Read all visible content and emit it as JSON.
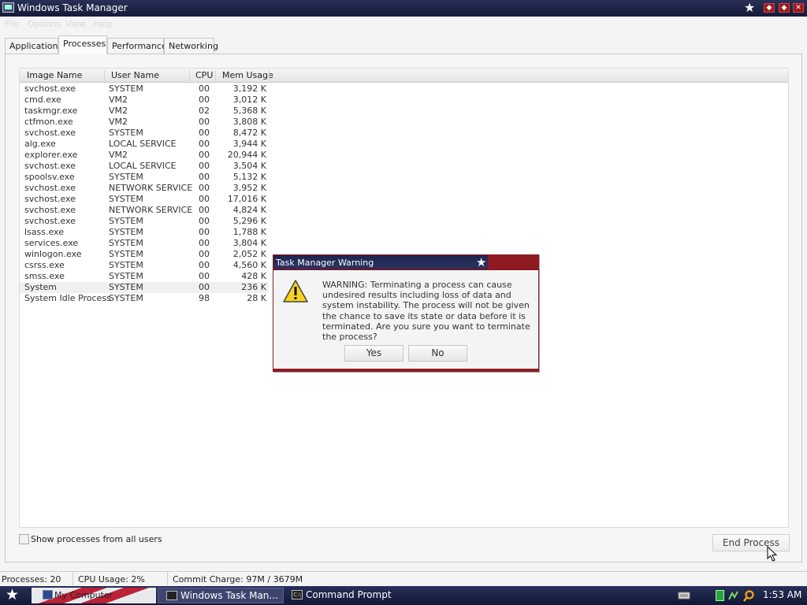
{
  "window": {
    "title": "Windows Task Manager"
  },
  "menu": [
    "File",
    "Options",
    "View",
    "Help"
  ],
  "tabs": [
    "Applications",
    "Processes",
    "Performance",
    "Networking"
  ],
  "active_tab": "Processes",
  "columns": [
    "Image Name",
    "User Name",
    "CPU",
    "Mem Usage"
  ],
  "processes": [
    {
      "name": "svchost.exe",
      "user": "SYSTEM",
      "cpu": "00",
      "mem": "3,192 K"
    },
    {
      "name": "cmd.exe",
      "user": "VM2",
      "cpu": "00",
      "mem": "3,012 K"
    },
    {
      "name": "taskmgr.exe",
      "user": "VM2",
      "cpu": "02",
      "mem": "5,368 K"
    },
    {
      "name": "ctfmon.exe",
      "user": "VM2",
      "cpu": "00",
      "mem": "3,808 K"
    },
    {
      "name": "svchost.exe",
      "user": "SYSTEM",
      "cpu": "00",
      "mem": "8,472 K"
    },
    {
      "name": "alg.exe",
      "user": "LOCAL SERVICE",
      "cpu": "00",
      "mem": "3,944 K"
    },
    {
      "name": "explorer.exe",
      "user": "VM2",
      "cpu": "00",
      "mem": "20,944 K"
    },
    {
      "name": "svchost.exe",
      "user": "LOCAL SERVICE",
      "cpu": "00",
      "mem": "3,504 K"
    },
    {
      "name": "spoolsv.exe",
      "user": "SYSTEM",
      "cpu": "00",
      "mem": "5,132 K"
    },
    {
      "name": "svchost.exe",
      "user": "NETWORK SERVICE",
      "cpu": "00",
      "mem": "3,952 K"
    },
    {
      "name": "svchost.exe",
      "user": "SYSTEM",
      "cpu": "00",
      "mem": "17,016 K"
    },
    {
      "name": "svchost.exe",
      "user": "NETWORK SERVICE",
      "cpu": "00",
      "mem": "4,824 K"
    },
    {
      "name": "svchost.exe",
      "user": "SYSTEM",
      "cpu": "00",
      "mem": "5,296 K"
    },
    {
      "name": "lsass.exe",
      "user": "SYSTEM",
      "cpu": "00",
      "mem": "1,788 K"
    },
    {
      "name": "services.exe",
      "user": "SYSTEM",
      "cpu": "00",
      "mem": "3,804 K"
    },
    {
      "name": "winlogon.exe",
      "user": "SYSTEM",
      "cpu": "00",
      "mem": "2,052 K"
    },
    {
      "name": "csrss.exe",
      "user": "SYSTEM",
      "cpu": "00",
      "mem": "4,560 K"
    },
    {
      "name": "smss.exe",
      "user": "SYSTEM",
      "cpu": "00",
      "mem": "428 K"
    },
    {
      "name": "System",
      "user": "SYSTEM",
      "cpu": "00",
      "mem": "236 K"
    },
    {
      "name": "System Idle Process",
      "user": "SYSTEM",
      "cpu": "98",
      "mem": "28 K"
    }
  ],
  "selected_row": 18,
  "show_all_label": "Show processes from all users",
  "end_process_label": "End Process",
  "status": {
    "processes": "Processes: 20",
    "cpu": "CPU Usage: 2%",
    "commit": "Commit Charge: 97M / 3679M"
  },
  "dialog": {
    "title": "Task Manager Warning",
    "message": "WARNING: Terminating a process can cause undesired results including loss of data and system instability. The process will not be given the chance to save its state or data before it is terminated.  Are you sure you want to terminate the process?",
    "yes": "Yes",
    "no": "No"
  },
  "taskbar": {
    "items": [
      "My Computer",
      "Windows Task Man...",
      "Command Prompt"
    ],
    "clock": "1:53 AM"
  },
  "colors": {
    "title_bg": "#1e2550",
    "accent_red": "#8e1b22"
  }
}
